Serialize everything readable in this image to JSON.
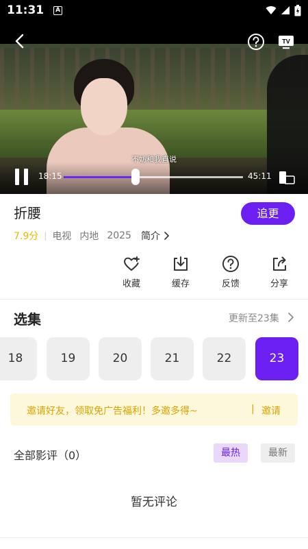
{
  "status_bar": {
    "time": "11:31",
    "a_badge": "A"
  },
  "player": {
    "subtitle": "不妨和我直说",
    "current_time": "18:15",
    "total_time": "45:11",
    "progress_fraction": 0.4,
    "accent": "#6b28f0"
  },
  "drama": {
    "title": "折腰",
    "follow_label": "追更",
    "score": "7.9分",
    "type": "电视",
    "region": "内地",
    "year": "2025",
    "intro_label": "简介"
  },
  "actions": [
    {
      "label": "收藏",
      "icon": "heart-plus-icon"
    },
    {
      "label": "缓存",
      "icon": "download-icon"
    },
    {
      "label": "反馈",
      "icon": "help-icon"
    },
    {
      "label": "分享",
      "icon": "share-icon"
    }
  ],
  "episodes": {
    "heading": "选集",
    "update_text": "更新至23集",
    "items": [
      "18",
      "19",
      "20",
      "21",
      "22",
      "23"
    ],
    "active": "23"
  },
  "invite": {
    "text": "邀请好友，领取免广告福利！多邀多得~",
    "separator": "|",
    "button": "邀请"
  },
  "reviews": {
    "heading": "全部影评（0）",
    "sort_hot": "最热",
    "sort_new": "最新",
    "empty_text": "暂无评论"
  },
  "colors": {
    "brand": "#6b1ff0",
    "gold": "#d9a300",
    "score": "#f0b400"
  }
}
